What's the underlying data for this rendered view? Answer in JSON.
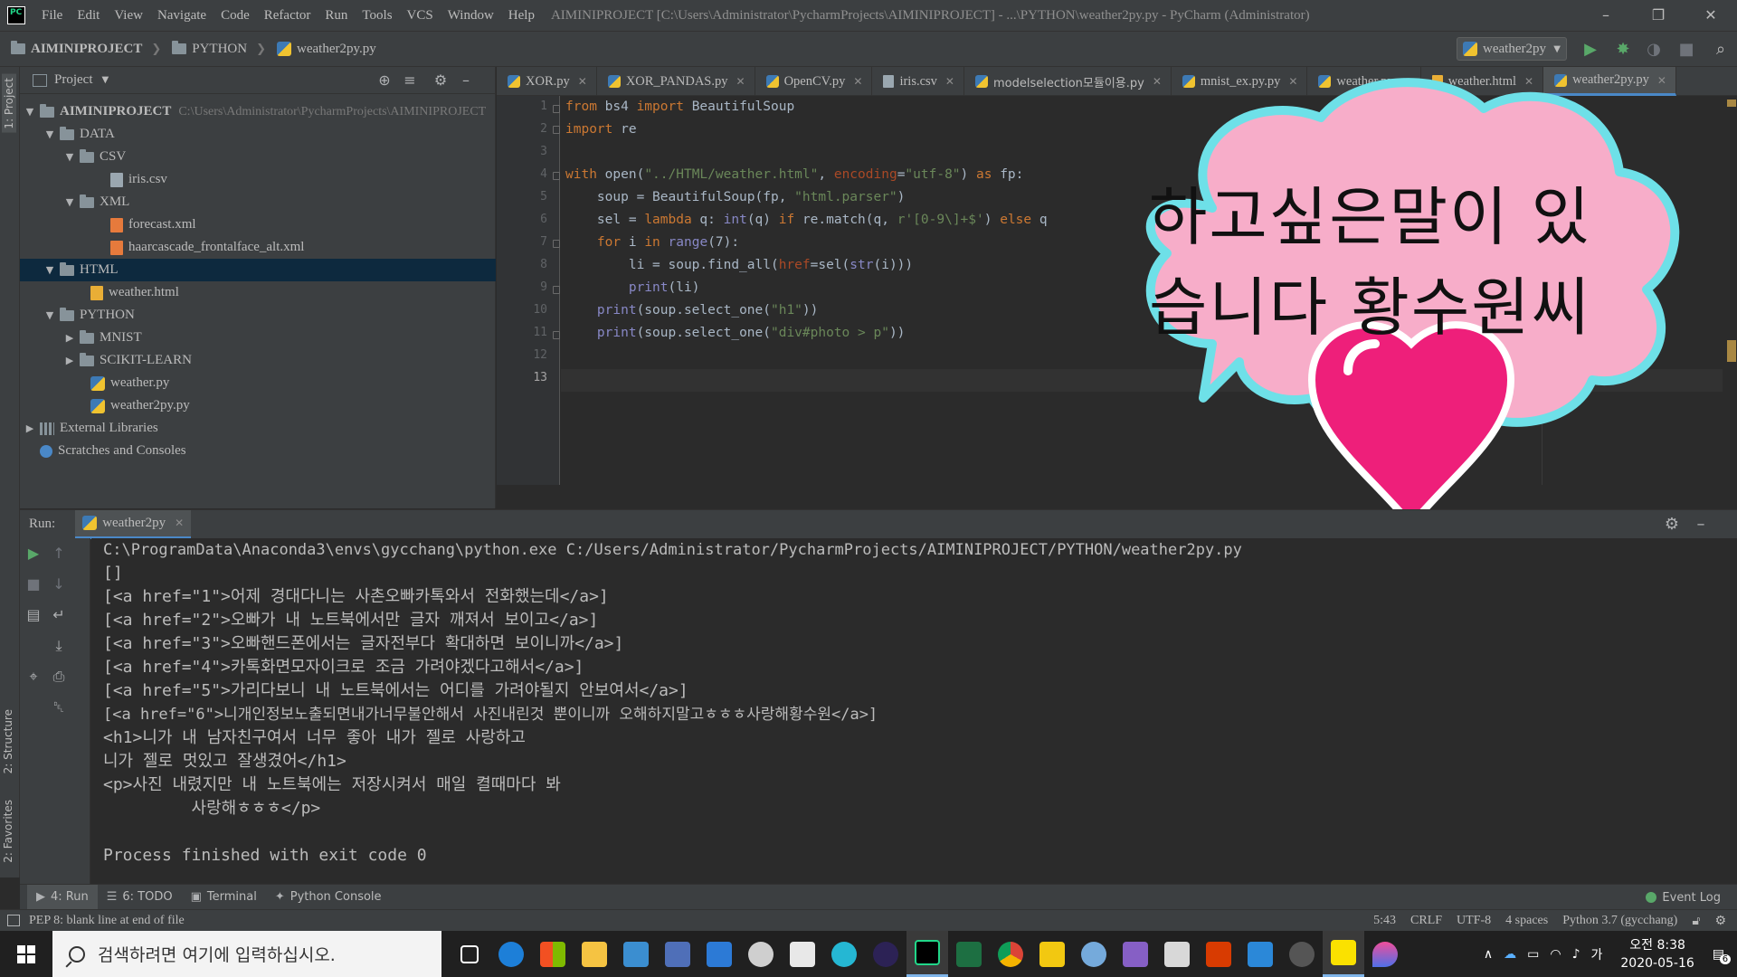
{
  "menu": {
    "items": [
      "File",
      "Edit",
      "View",
      "Navigate",
      "Code",
      "Refactor",
      "Run",
      "Tools",
      "VCS",
      "Window",
      "Help"
    ],
    "window_title": "AIMINIPROJECT [C:\\Users\\Administrator\\PycharmProjects\\AIMINIPROJECT] - ...\\PYTHON\\weather2py.py - PyCharm (Administrator)"
  },
  "breadcrumbs": [
    "AIMINIPROJECT",
    "PYTHON",
    "weather2py.py"
  ],
  "run_config": "weather2py",
  "left_strip": {
    "project_tab": "1: Project",
    "structure_tab": "2: Structure",
    "favorites_tab": "2: Favorites"
  },
  "project_panel": {
    "title": "Project",
    "tree": [
      {
        "label": "AIMINIPROJECT",
        "path": "C:\\Users\\Administrator\\PycharmProjects\\AIMINIPROJECT"
      },
      {
        "label": "DATA"
      },
      {
        "label": "CSV"
      },
      {
        "label": "iris.csv"
      },
      {
        "label": "XML"
      },
      {
        "label": "forecast.xml"
      },
      {
        "label": "haarcascade_frontalface_alt.xml"
      },
      {
        "label": "HTML"
      },
      {
        "label": "weather.html"
      },
      {
        "label": "PYTHON"
      },
      {
        "label": "MNIST"
      },
      {
        "label": "SCIKIT-LEARN"
      },
      {
        "label": "weather.py"
      },
      {
        "label": "weather2py.py"
      },
      {
        "label": "External Libraries"
      },
      {
        "label": "Scratches and Consoles"
      }
    ]
  },
  "editor": {
    "tabs": [
      "XOR.py",
      "XOR_PANDAS.py",
      "OpenCV.py",
      "iris.csv",
      "modelselection모듈이용.py",
      "mnist_ex.py.py",
      "weather.py",
      "weather.html",
      "weather2py.py"
    ],
    "line_numbers": [
      "1",
      "2",
      "3",
      "4",
      "5",
      "6",
      "7",
      "8",
      "9",
      "10",
      "11",
      "12",
      "13"
    ]
  },
  "code": {
    "l1_a": "from",
    "l1_b": " bs4 ",
    "l1_c": "import",
    "l1_d": " BeautifulSoup",
    "l2_a": "import",
    "l2_b": " re",
    "l4_a": "with",
    "l4_b": " open(",
    "l4_c": "\"../HTML/weather.html\"",
    "l4_d": ", ",
    "l4_e": "encoding",
    "l4_f": "=",
    "l4_g": "\"utf-8\"",
    "l4_h": ") ",
    "l4_i": "as",
    "l4_j": " fp:",
    "l5_a": "    soup = BeautifulSoup(fp, ",
    "l5_b": "\"html.parser\"",
    "l5_c": ")",
    "l6_a": "    sel = ",
    "l6_b": "lambda",
    "l6_c": " q: ",
    "l6_d": "int",
    "l6_e": "(q) ",
    "l6_f": "if",
    "l6_g": " re.match(q, ",
    "l6_h": "r'[0-9\\]+$'",
    "l6_i": ") ",
    "l6_j": "else",
    "l6_k": " q",
    "l7_a": "    ",
    "l7_b": "for",
    "l7_c": " i ",
    "l7_d": "in",
    "l7_e": " ",
    "l7_f": "range",
    "l7_g": "(7):",
    "l8_a": "        li = soup.find_all(",
    "l8_b": "href",
    "l8_c": "=sel(",
    "l8_d": "str",
    "l8_e": "(i)))",
    "l9_a": "        ",
    "l9_b": "print",
    "l9_c": "(li)",
    "l10_a": "    ",
    "l10_b": "print",
    "l10_c": "(soup.select_one(",
    "l10_d": "\"h1\"",
    "l10_e": "))",
    "l11_a": "    ",
    "l11_b": "print",
    "l11_c": "(soup.select_one(",
    "l11_d": "\"div#photo > p\"",
    "l11_e": "))"
  },
  "run_panel": {
    "label": "Run:",
    "tab": "weather2py",
    "console": [
      "C:\\ProgramData\\Anaconda3\\envs\\gycchang\\python.exe C:/Users/Administrator/PycharmProjects/AIMINIPROJECT/PYTHON/weather2py.py",
      "[]",
      "[<a href=\"1\">어제 경대다니는 사촌오빠카톡와서 전화했는데</a>]",
      "[<a href=\"2\">오빠가 내 노트북에서만 글자 깨져서 보이고</a>]",
      "[<a href=\"3\">오빠핸드폰에서는 글자전부다 확대하면 보이니까</a>]",
      "[<a href=\"4\">카톡화면모자이크로 조금 가려야겠다고해서</a>]",
      "[<a href=\"5\">가리다보니 내 노트북에서는 어디를 가려야될지 안보여서</a>]",
      "[<a href=\"6\">니개인정보노출되면내가너무불안해서 사진내린것 뿐이니까 오해하지말고ㅎㅎㅎ사랑해황수원</a>]",
      "<h1>니가 내 남자친구여서 너무 좋아 내가 젤로 사랑하고",
      "니가 젤로 멋있고 잘생겼어</h1>",
      "<p>사진 내렸지만 내 노트북에는 저장시켜서 매일 켤때마다 봐",
      "         사랑해ㅎㅎㅎ</p>",
      "",
      "Process finished with exit code 0"
    ]
  },
  "tool_windows": {
    "run": "4: Run",
    "todo": "6: TODO",
    "terminal": "Terminal",
    "python_console": "Python Console",
    "event_log": "Event Log"
  },
  "status": {
    "message": "PEP 8: blank line at end of file",
    "position": "5:43",
    "line_sep": "CRLF",
    "encoding": "UTF-8",
    "indent": "4 spaces",
    "interpreter": "Python 3.7 (gycchang)"
  },
  "overlay": {
    "line1": "하고싶은말이 있",
    "line2": "습니다 황수원씨"
  },
  "taskbar": {
    "search_placeholder": "검색하려면 여기에 입력하십시오.",
    "ime": "가",
    "time": "오전 8:38",
    "date": "2020-05-16",
    "notifications": "6"
  },
  "colors": {
    "accent": "#4a88c7",
    "cloud_fill": "#f7adc9",
    "cloud_border": "#6ee0e8",
    "heart": "#ee1f7a"
  }
}
